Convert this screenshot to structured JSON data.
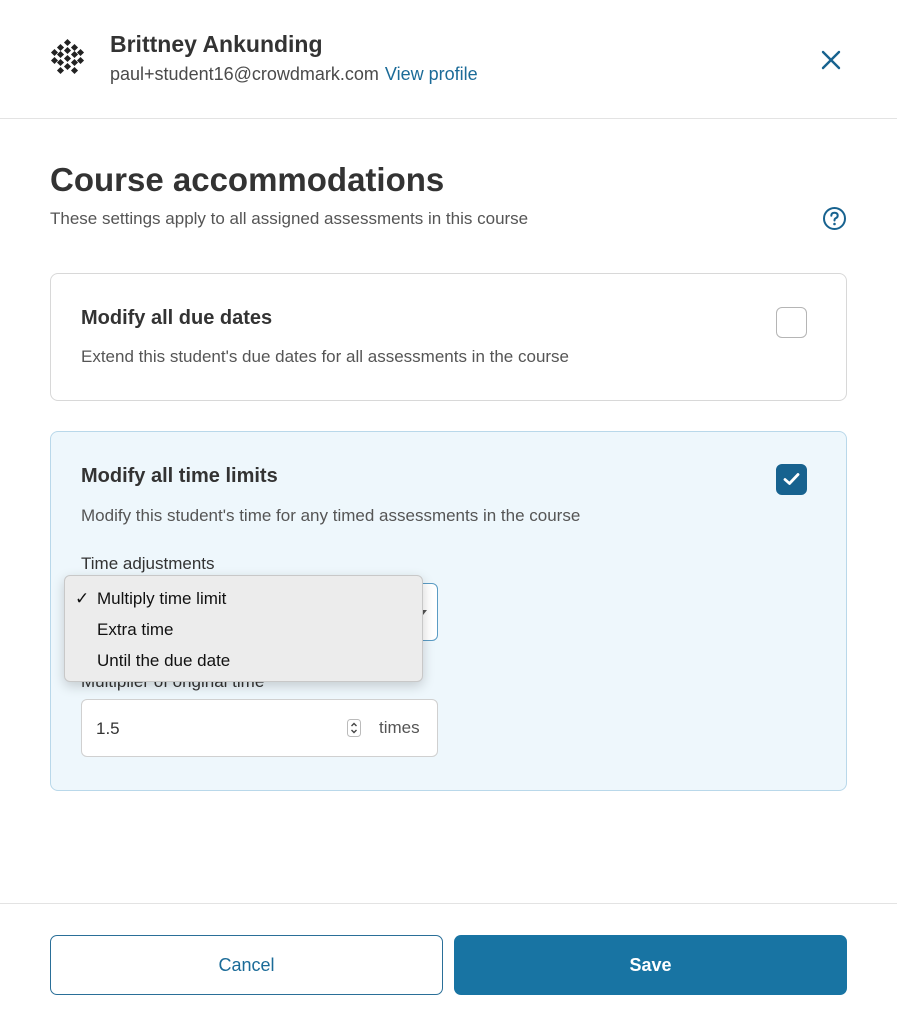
{
  "header": {
    "user_name": "Brittney Ankunding",
    "user_email": "paul+student16@crowdmark.com",
    "view_profile_label": "View profile"
  },
  "page": {
    "title": "Course accommodations",
    "subtitle": "These settings apply to all assigned assessments in this course"
  },
  "due_dates_card": {
    "title": "Modify all due dates",
    "description": "Extend this student's due dates for all assessments in the course",
    "checked": false
  },
  "time_limits_card": {
    "title": "Modify all time limits",
    "description": "Modify this student's time for any timed assessments in the course",
    "checked": true,
    "time_adjustments_label": "Time adjustments",
    "selected_option": "Multiply time limit",
    "options": [
      "Multiply time limit",
      "Extra time",
      "Until the due date"
    ],
    "multiplier_label": "Multiplier of original time",
    "multiplier_value": "1.5",
    "multiplier_unit": "times"
  },
  "footer": {
    "cancel_label": "Cancel",
    "save_label": "Save"
  },
  "colors": {
    "accent": "#1874a3",
    "link": "#1b6b98",
    "card_highlight": "#eef7fc"
  }
}
